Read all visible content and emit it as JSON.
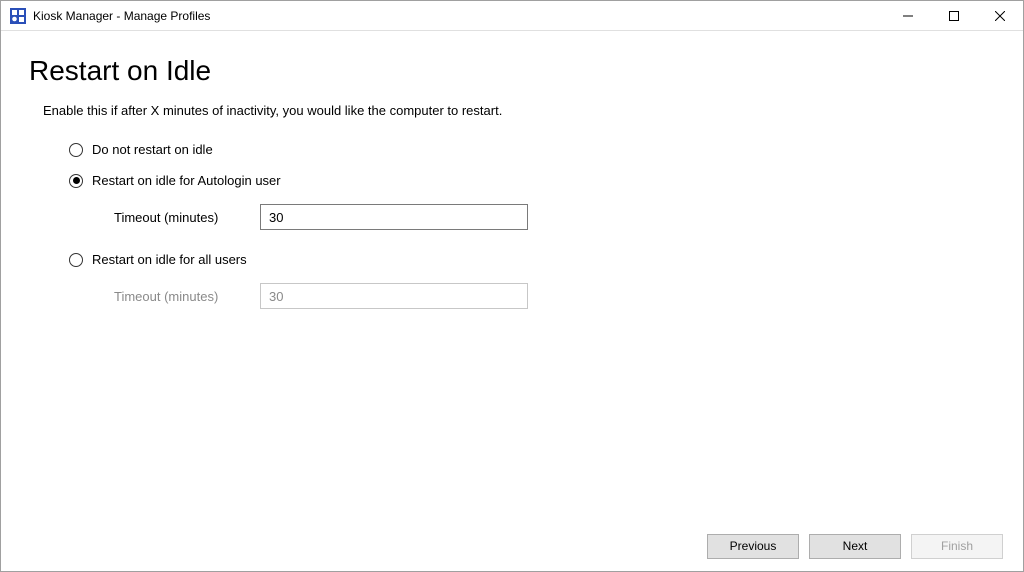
{
  "window": {
    "title": "Kiosk Manager - Manage Profiles"
  },
  "page": {
    "title": "Restart on Idle",
    "description": "Enable this if after X minutes of inactivity, you would like the computer to restart."
  },
  "options": {
    "no_restart": {
      "label": "Do not restart on idle",
      "selected": false
    },
    "autologin": {
      "label": "Restart on idle for Autologin user",
      "selected": true,
      "timeout_label": "Timeout (minutes)",
      "timeout_value": "30"
    },
    "all_users": {
      "label": "Restart on idle for all users",
      "selected": false,
      "timeout_label": "Timeout (minutes)",
      "timeout_value": "30"
    }
  },
  "footer": {
    "previous": "Previous",
    "next": "Next",
    "finish": "Finish"
  }
}
